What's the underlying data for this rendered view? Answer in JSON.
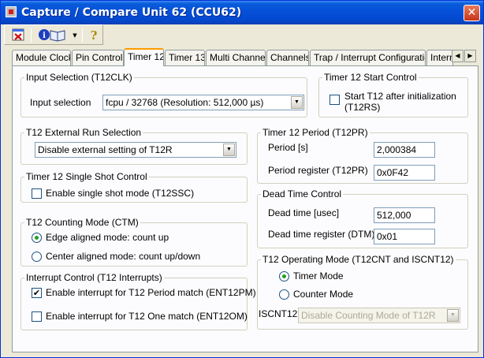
{
  "window": {
    "title": "Capture / Compare Unit 62 (CCU62)",
    "close_glyph": "✕"
  },
  "toolbar": {
    "icons": [
      "close-doc-icon",
      "info-book-icon",
      "dropdown-arrow-icon",
      "help-icon"
    ],
    "help_glyph": "?"
  },
  "tabs": [
    {
      "label": "Module Clock"
    },
    {
      "label": "Pin Control"
    },
    {
      "label": "Timer 12",
      "active": true
    },
    {
      "label": "Timer 13"
    },
    {
      "label": "Multi Channel"
    },
    {
      "label": "Channels"
    },
    {
      "label": "Trap / Interrupt Configuration"
    },
    {
      "label": "Interr"
    }
  ],
  "tab_scroll": {
    "left": "◀",
    "right": "▶"
  },
  "input_selection": {
    "legend": "Input Selection (T12CLK)",
    "label": "Input selection",
    "value": "fcpu / 32768 (Resolution: 512,000 µs)"
  },
  "start_control": {
    "legend": "Timer 12 Start Control",
    "checkbox_label_1": "Start T12 after initialization",
    "checkbox_label_2": "(T12RS)",
    "checked": false
  },
  "external_run": {
    "legend": "T12 External Run Selection",
    "value": "Disable external setting of T12R"
  },
  "single_shot": {
    "legend": "Timer 12 Single Shot Control",
    "checkbox_label": "Enable single shot mode (T12SSC)",
    "checked": false
  },
  "counting_mode": {
    "legend": "T12 Counting Mode (CTM)",
    "option_edge": "Edge aligned mode: count up",
    "option_center": "Center aligned mode: count up/down",
    "selected": "edge"
  },
  "interrupt_control": {
    "legend": "Interrupt Control  (T12 Interrupts)",
    "period_label": "Enable interrupt for T12 Period match (ENT12PM)",
    "period_checked": true,
    "one_label": "Enable interrupt for T12 One match (ENT12OM)",
    "one_checked": false
  },
  "period": {
    "legend": "Timer 12 Period (T12PR)",
    "period_label": "Period [s]",
    "period_value": "2,000384",
    "register_label": "Period register (T12PR)",
    "register_value": "0x0F42"
  },
  "dead_time": {
    "legend": "Dead Time Control",
    "time_label": "Dead time [usec]",
    "time_value": "512,000",
    "register_label": "Dead time register (DTM)",
    "register_value": "0x01"
  },
  "operating_mode": {
    "legend": "T12 Operating Mode (T12CNT and  ISCNT12)",
    "option_timer": "Timer Mode",
    "option_counter": "Counter Mode",
    "selected": "timer",
    "iscnt_label": "ISCNT12",
    "iscnt_value": "Disable Counting Mode of T12R"
  },
  "check_glyph": "✔"
}
